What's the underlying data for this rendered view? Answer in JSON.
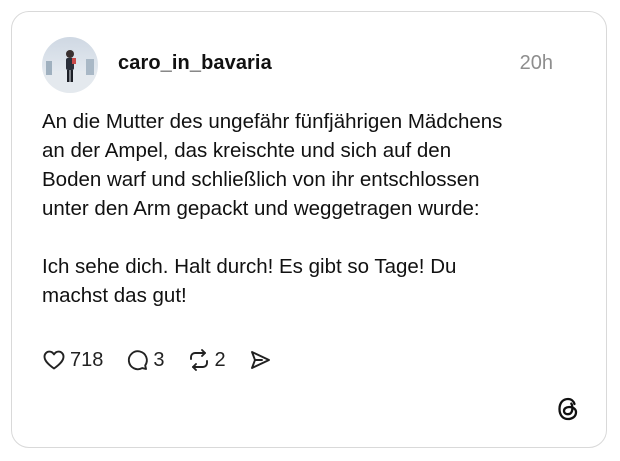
{
  "post": {
    "username": "caro_in_bavaria",
    "timestamp": "20h",
    "paragraph_1_lines": [
      "An die Mutter des ungefähr fünfjährigen Mädchens",
      "an der Ampel, das kreischte und sich auf den",
      "Boden warf und schließlich von ihr entschlossen",
      "unter den Arm gepackt und weggetragen wurde:"
    ],
    "paragraph_2_lines": [
      "Ich sehe dich. Halt durch! Es gibt so Tage! Du",
      "machst das gut!"
    ]
  },
  "actions": {
    "like_count": "718",
    "reply_count": "3",
    "repost_count": "2"
  },
  "icons": {
    "like": "heart-icon",
    "reply": "speech-bubble-icon",
    "repost": "repost-arrows-icon",
    "share": "send-icon",
    "brand": "threads-logo-icon"
  },
  "colors": {
    "text": "#111111",
    "muted": "#8e8e8e",
    "border": "#d9d9d9"
  }
}
